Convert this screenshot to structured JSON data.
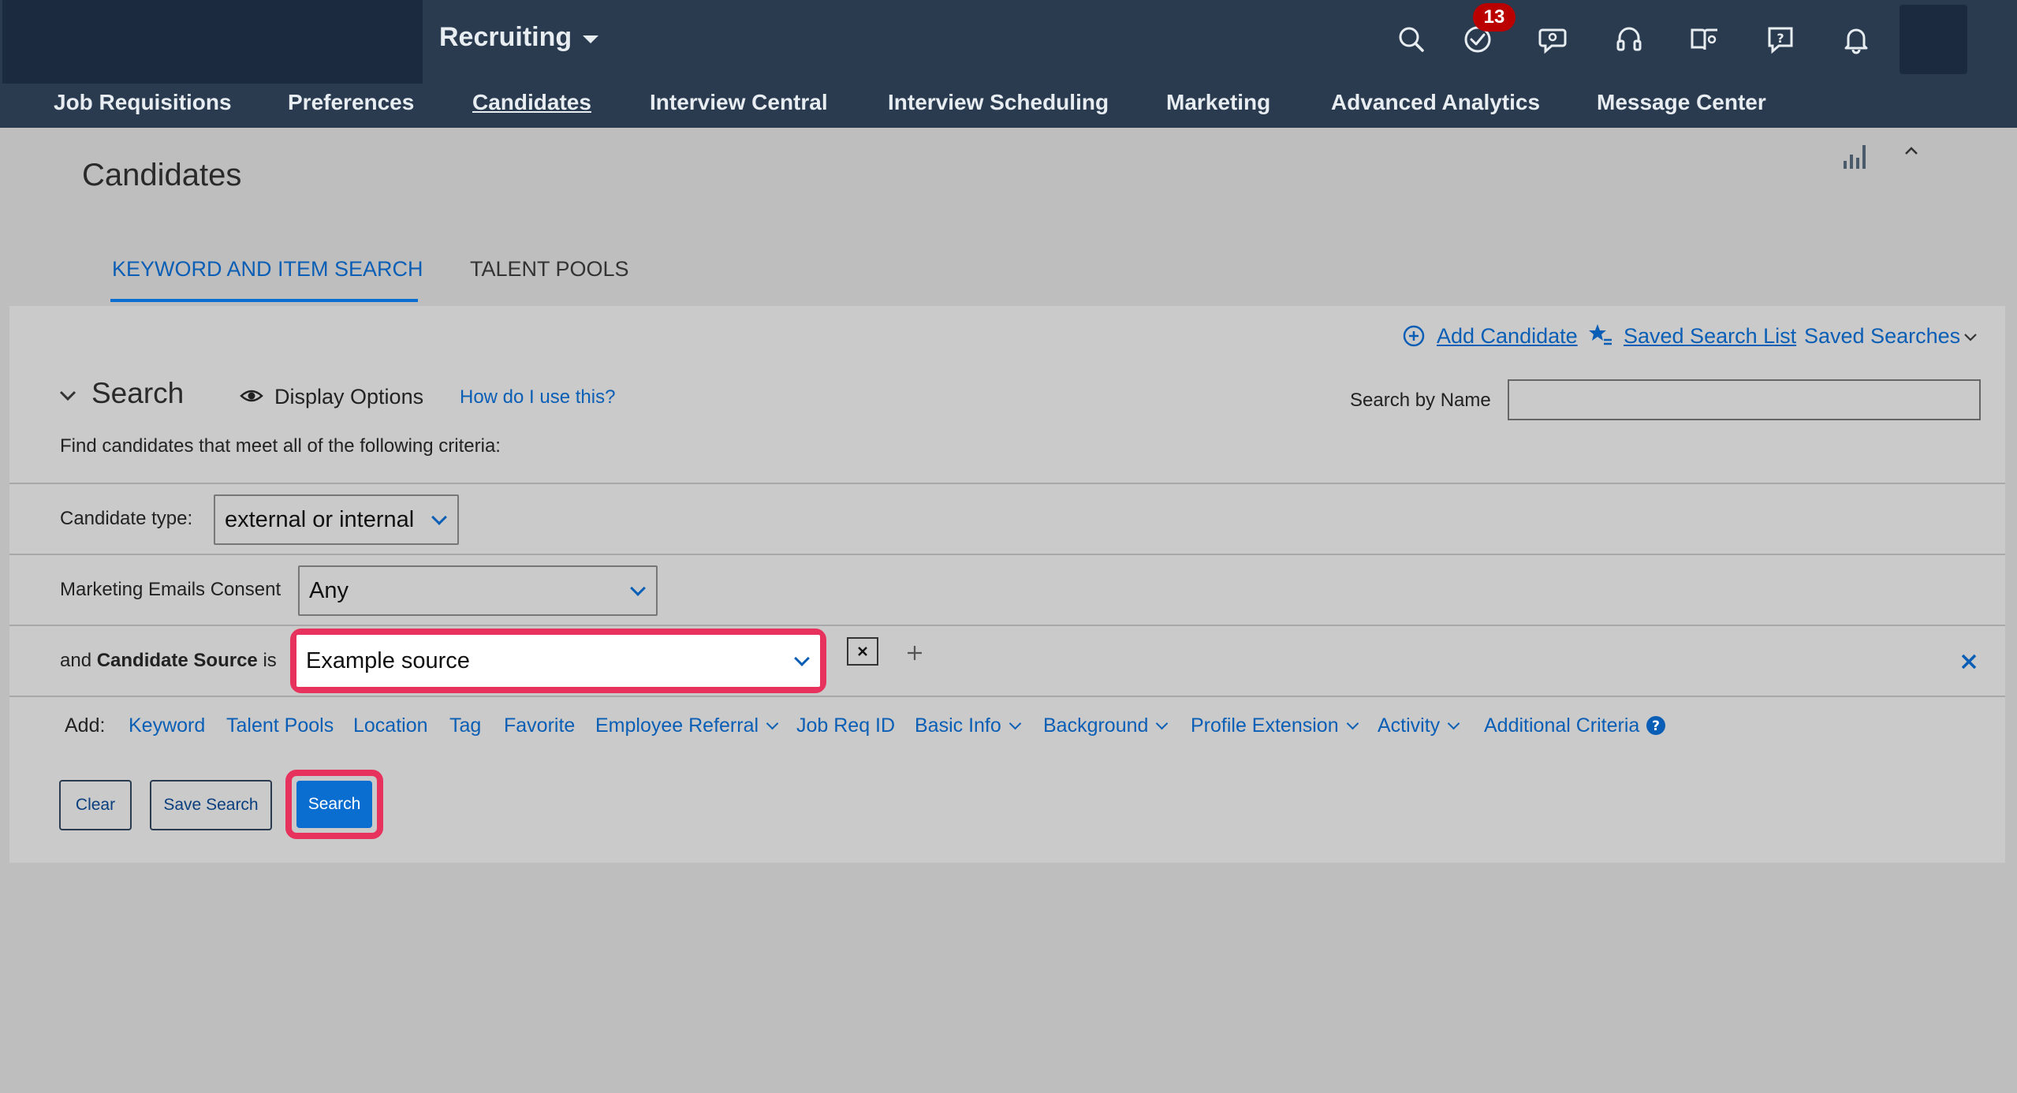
{
  "header": {
    "app_title": "Recruiting",
    "notification_count": "13",
    "icons": [
      "search-icon",
      "todo-check-icon",
      "chat-bot-icon",
      "headset-icon",
      "book-user-icon",
      "help-chat-icon",
      "bell-icon"
    ]
  },
  "nav": {
    "items": [
      {
        "label": "Job Requisitions"
      },
      {
        "label": "Preferences"
      },
      {
        "label": "Candidates"
      },
      {
        "label": "Interview Central"
      },
      {
        "label": "Interview Scheduling"
      },
      {
        "label": "Marketing"
      },
      {
        "label": "Advanced Analytics"
      },
      {
        "label": "Message Center"
      }
    ]
  },
  "page": {
    "title": "Candidates"
  },
  "tabs": {
    "keyword": "KEYWORD AND ITEM SEARCH",
    "talent_pools": "TALENT POOLS"
  },
  "actions": {
    "add_candidate": "Add Candidate",
    "saved_search_list": "Saved Search List",
    "saved_searches": "Saved Searches"
  },
  "search": {
    "heading": "Search",
    "display_options": "Display Options",
    "how_to": "How do I use this?",
    "by_name_label": "Search by Name",
    "by_name_value": "",
    "criteria_intro": "Find candidates that meet all of the following criteria:"
  },
  "criteria": {
    "candidate_type_label": "Candidate type:",
    "candidate_type_value": "external or internal",
    "marketing_label": "Marketing Emails Consent",
    "marketing_value": "Any",
    "source_prefix": "and",
    "source_field": "Candidate Source",
    "source_suffix": "is",
    "source_value": "Example source"
  },
  "add_bar": {
    "label": "Add:",
    "links": [
      "Keyword",
      "Talent Pools",
      "Location",
      "Tag",
      "Favorite",
      "Employee Referral",
      "Job Req ID",
      "Basic Info",
      "Background",
      "Profile Extension",
      "Activity",
      "Additional Criteria"
    ]
  },
  "buttons": {
    "clear": "Clear",
    "save_search": "Save Search",
    "search": "Search"
  },
  "colors": {
    "header_bg": "#2a3b50",
    "accent": "#0a6ed1",
    "highlight": "#e8325e",
    "badge": "#bb0000"
  }
}
